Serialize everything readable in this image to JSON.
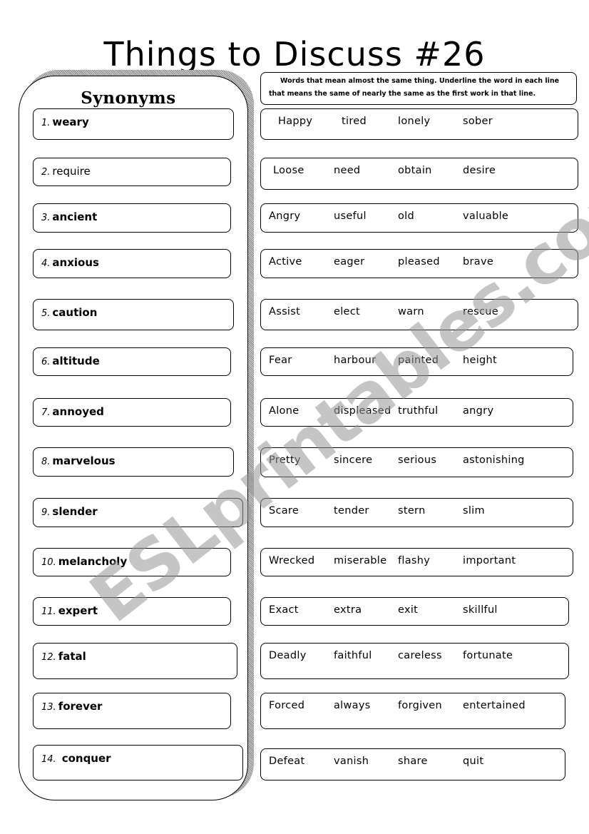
{
  "title": "Things to Discuss #26",
  "panel_heading": "Synonyms",
  "instructions": {
    "line1": "Words that mean almost the same thing.  Underline the word in each line",
    "line2": "that means the same of nearly the same as the first work in that line."
  },
  "rows": [
    {
      "num": "1.",
      "word": "weary",
      "choices": [
        "Happy",
        "tired",
        "lonely",
        "sober"
      ]
    },
    {
      "num": "2.",
      "word": "require",
      "choices": [
        "Loose",
        "need",
        "obtain",
        "desire"
      ]
    },
    {
      "num": "3.",
      "word": "ancient",
      "choices": [
        "Angry",
        "useful",
        "old",
        "valuable"
      ]
    },
    {
      "num": "4.",
      "word": "anxious",
      "choices": [
        "Active",
        "eager",
        "pleased",
        "brave"
      ]
    },
    {
      "num": "5.",
      "word": "caution",
      "choices": [
        "Assist",
        "elect",
        "warn",
        "rescue"
      ]
    },
    {
      "num": "6.",
      "word": "altitude",
      "choices": [
        "Fear",
        "harbour",
        "painted",
        "height"
      ]
    },
    {
      "num": "7.",
      "word": "annoyed",
      "choices": [
        "Alone",
        "displeased",
        "truthful",
        "angry"
      ]
    },
    {
      "num": "8.",
      "word": "marvelous",
      "choices": [
        "Pretty",
        "sincere",
        "serious",
        "astonishing"
      ]
    },
    {
      "num": "9.",
      "word": "slender",
      "choices": [
        "Scare",
        "tender",
        "stern",
        "slim"
      ]
    },
    {
      "num": "10.",
      "word": "melancholy",
      "choices": [
        "Wrecked",
        "miserable",
        "flashy",
        "important"
      ]
    },
    {
      "num": "11.",
      "word": "expert",
      "choices": [
        "Exact",
        "extra",
        "exit",
        "skillful"
      ]
    },
    {
      "num": "12.",
      "word": "fatal",
      "choices": [
        "Deadly",
        "faithful",
        "careless",
        "fortunate"
      ]
    },
    {
      "num": "13.",
      "word": "forever",
      "choices": [
        "Forced",
        "always",
        "forgiven",
        "entertained"
      ]
    },
    {
      "num": "14.",
      "word": "conquer",
      "choices": [
        "Defeat",
        "vanish",
        "share",
        "quit"
      ]
    }
  ],
  "watermark": "ESLprintables.com"
}
